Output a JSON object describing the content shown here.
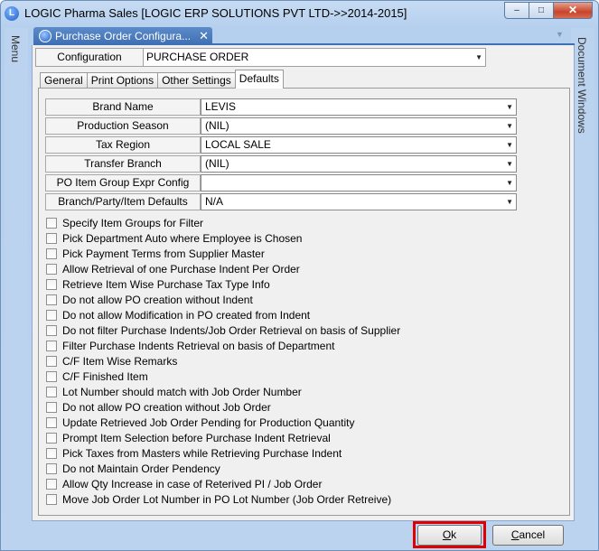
{
  "window": {
    "title": "LOGIC Pharma Sales  [LOGIC ERP SOLUTIONS PVT LTD->>2014-2015]",
    "controls": {
      "minimize": "–",
      "maximize": "□",
      "close": "✕"
    }
  },
  "side_panels": {
    "left_label": "Menu",
    "right_label": "Document Windows"
  },
  "document_tab": {
    "label": "Purchase Order Configura...",
    "close": "✕"
  },
  "configuration": {
    "label": "Configuration",
    "value": "PURCHASE ORDER"
  },
  "tabs": [
    "General",
    "Print Options",
    "Other Settings",
    "Defaults"
  ],
  "fields": [
    {
      "label": "Brand Name",
      "value": "LEVIS"
    },
    {
      "label": "Production Season",
      "value": "(NIL)"
    },
    {
      "label": "Tax Region",
      "value": "LOCAL SALE"
    },
    {
      "label": "Transfer Branch",
      "value": "(NIL)"
    },
    {
      "label": "PO Item Group Expr Config",
      "value": ""
    },
    {
      "label": "Branch/Party/Item Defaults",
      "value": "N/A"
    }
  ],
  "checkboxes": [
    "Specify Item Groups for Filter",
    "Pick Department Auto where Employee is Chosen",
    "Pick Payment Terms from Supplier Master",
    "Allow Retrieval of one Purchase Indent Per Order",
    "Retrieve Item Wise Purchase Tax Type Info",
    "Do not allow PO creation without Indent",
    "Do not allow Modification in PO created from Indent",
    "Do not filter Purchase Indents/Job Order Retrieval on basis of Supplier",
    "Filter Purchase Indents Retrieval on basis of Department",
    "C/F Item Wise Remarks",
    "C/F Finished Item",
    "Lot Number should match with Job Order Number",
    "Do not allow PO creation without Job Order",
    "Update Retrieved Job Order Pending for Production Quantity",
    "Prompt Item Selection before Purchase Indent Retrieval",
    "Pick Taxes from Masters while Retrieving Purchase Indent",
    "Do not Maintain Order Pendency",
    "Allow Qty Increase in case of Reterived PI / Job Order",
    "Move Job Order Lot Number in PO Lot Number (Job Order Retreive)"
  ],
  "buttons": {
    "ok": "Ok",
    "cancel": "Cancel"
  },
  "colors": {
    "highlight": "#e00000",
    "tab_blue": "#3e6fb3"
  }
}
